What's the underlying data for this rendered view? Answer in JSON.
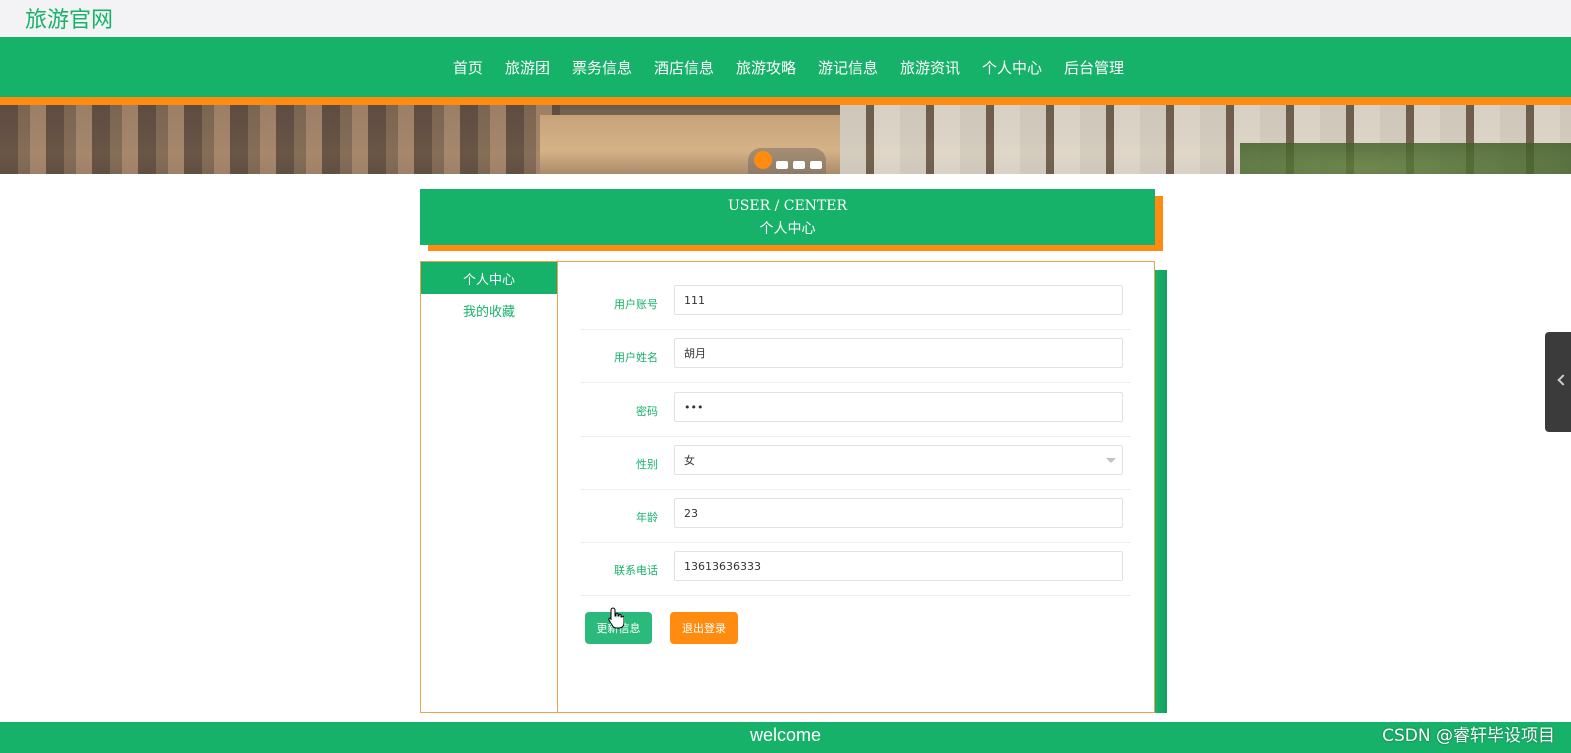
{
  "site": {
    "title": "旅游官网"
  },
  "nav": {
    "items": [
      "首页",
      "旅游团",
      "票务信息",
      "酒店信息",
      "旅游攻略",
      "游记信息",
      "旅游资讯",
      "个人中心",
      "后台管理"
    ]
  },
  "banner": {
    "slides": 4,
    "active_slide": 1
  },
  "section": {
    "title_en": "USER / CENTER",
    "title_cn": "个人中心"
  },
  "sidebar": {
    "items": [
      {
        "label": "个人中心",
        "active": true
      },
      {
        "label": "我的收藏",
        "active": false
      }
    ]
  },
  "form": {
    "fields": [
      {
        "label": "用户账号",
        "value": "111"
      },
      {
        "label": "用户姓名",
        "value": "胡月"
      },
      {
        "label": "密码",
        "value": "•••"
      },
      {
        "label": "性别",
        "value": "女"
      },
      {
        "label": "年龄",
        "value": "23"
      },
      {
        "label": "联系电话",
        "value": "13613636333"
      }
    ],
    "update_button": "更新信息",
    "logout_button": "退出登录"
  },
  "footer": {
    "text": "welcome"
  },
  "watermark": {
    "text": "CSDN @睿轩毕设项目"
  },
  "colors": {
    "primary": "#17b26a",
    "accent": "#ff8c10"
  }
}
